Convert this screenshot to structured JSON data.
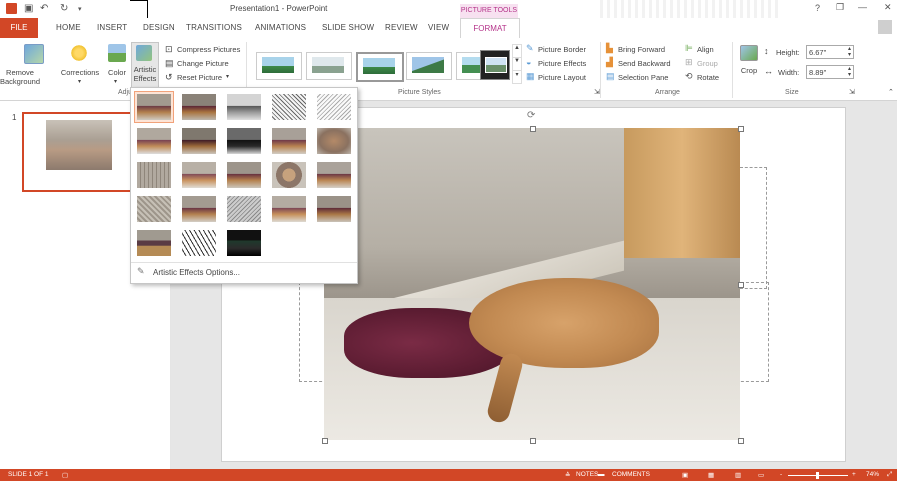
{
  "window": {
    "title": "Presentation1 - PowerPoint",
    "contextual_group": "PICTURE TOOLS",
    "help_glyph": "?",
    "minimize_glyph": "—",
    "restore_glyph": "❐",
    "close_glyph": "✕"
  },
  "tabs": [
    {
      "label": "FILE"
    },
    {
      "label": "HOME"
    },
    {
      "label": "INSERT"
    },
    {
      "label": "DESIGN"
    },
    {
      "label": "TRANSITIONS"
    },
    {
      "label": "ANIMATIONS"
    },
    {
      "label": "SLIDE SHOW"
    },
    {
      "label": "REVIEW"
    },
    {
      "label": "VIEW"
    },
    {
      "label": "FORMAT"
    }
  ],
  "ribbon": {
    "adjust": {
      "remove_background": "Remove Background",
      "corrections": "Corrections",
      "color": "Color",
      "artistic_effects": "Artistic Effects",
      "compress": "Compress Pictures",
      "change": "Change Picture",
      "reset": "Reset Picture",
      "group_label": "Adju"
    },
    "picture_styles": {
      "group_label": "Picture Styles",
      "border": "Picture Border",
      "effects": "Picture Effects",
      "layout": "Picture Layout"
    },
    "arrange": {
      "group_label": "Arrange",
      "bring_forward": "Bring Forward",
      "send_backward": "Send Backward",
      "selection_pane": "Selection Pane",
      "align": "Align",
      "group": "Group",
      "rotate": "Rotate"
    },
    "size": {
      "group_label": "Size",
      "crop": "Crop",
      "height_label": "Height:",
      "height_value": "6.67\"",
      "width_label": "Width:",
      "width_value": "8.89\""
    }
  },
  "slides_panel": {
    "slide_number": "1"
  },
  "artistic_effects_menu": {
    "options_label": "Artistic Effects Options...",
    "effects": [
      "None",
      "Marker",
      "Pencil Grayscale",
      "Pencil Sketch",
      "Line Drawing",
      "Chalk Sketch",
      "Paint Strokes",
      "Paint Brush",
      "Glow Diffused",
      "Blur",
      "Light Screen",
      "Watercolor Sponge",
      "Film Grain",
      "Mosaic Bubbles",
      "Glass",
      "Cement",
      "Texturizer",
      "Crisscross Etching",
      "Pastels Smooth",
      "Plastic Wrap",
      "Cutout",
      "Photocopy",
      "Glow Edges"
    ]
  },
  "status": {
    "slide_of": "SLIDE 1 OF 1",
    "notes": "NOTES",
    "comments": "COMMENTS",
    "zoom_minus": "-",
    "zoom_plus": "+",
    "zoom": "74%"
  }
}
